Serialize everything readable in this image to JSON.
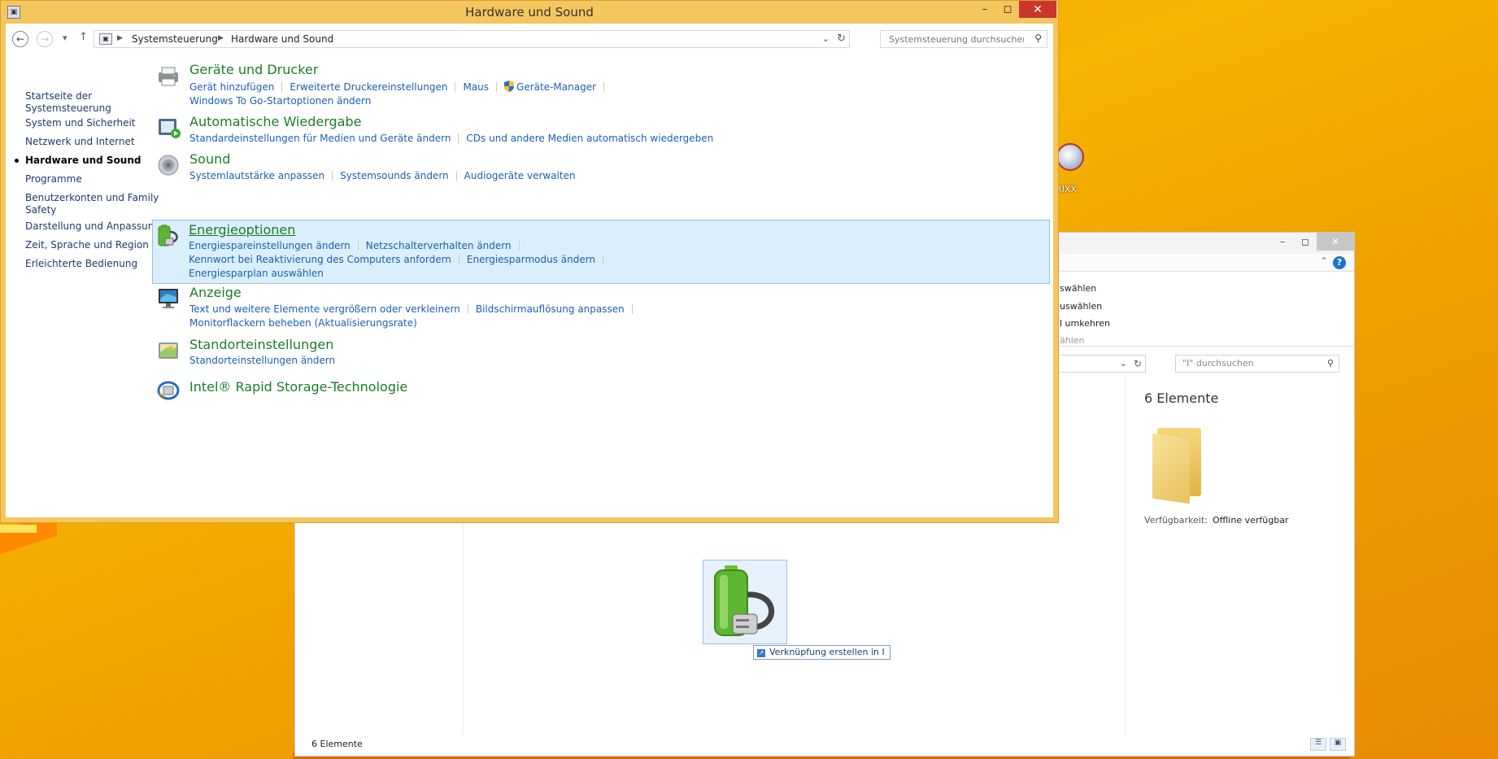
{
  "desktop": {
    "icon_label": "RIXX"
  },
  "explorer": {
    "ribbon_items": [
      "swählen",
      "uswählen",
      "l umkehren",
      "ählen"
    ],
    "search_placeholder": "\"I\" durchsuchen",
    "count_header": "6 Elemente",
    "availability_label": "Verfügbarkeit:",
    "availability_value": "Offline verfügbar",
    "status_text": "6 Elemente",
    "drag_tooltip": "Verknüpfung erstellen in I"
  },
  "window": {
    "title": "Hardware und Sound"
  },
  "address": {
    "crumbs": [
      "Systemsteuerung",
      "Hardware und Sound"
    ],
    "search_placeholder": "Systemsteuerung durchsuchen"
  },
  "sidebar": {
    "items": [
      {
        "label": "Startseite der Systemsteuerung",
        "active": false
      },
      {
        "label": "System und Sicherheit",
        "active": false
      },
      {
        "label": "Netzwerk und Internet",
        "active": false
      },
      {
        "label": "Hardware und Sound",
        "active": true
      },
      {
        "label": "Programme",
        "active": false
      },
      {
        "label": "Benutzerkonten und Family Safety",
        "active": false
      },
      {
        "label": "Darstellung und Anpassung",
        "active": false
      },
      {
        "label": "Zeit, Sprache und Region",
        "active": false
      },
      {
        "label": "Erleichterte Bedienung",
        "active": false
      }
    ]
  },
  "categories": [
    {
      "title": "Geräte und Drucker",
      "icon": "printer-icon",
      "rows": [
        [
          "Gerät hinzufügen",
          "Erweiterte Druckereinstellungen",
          "Maus",
          "Geräte-Manager"
        ],
        [
          "Windows To Go-Startoptionen ändern"
        ]
      ]
    },
    {
      "title": "Automatische Wiedergabe",
      "icon": "autoplay-icon",
      "rows": [
        [
          "Standardeinstellungen für Medien und Geräte ändern",
          "CDs und andere Medien automatisch wiedergeben"
        ]
      ]
    },
    {
      "title": "Sound",
      "icon": "speaker-icon",
      "rows": [
        [
          "Systemlautstärke anpassen",
          "Systemsounds ändern",
          "Audiogeräte verwalten"
        ]
      ]
    },
    {
      "title": "Energieoptionen",
      "icon": "battery-plug-icon",
      "rows": [
        [
          "Energiespareinstellungen ändern",
          "Netzschalterverhalten ändern"
        ],
        [
          "Kennwort bei Reaktivierung des Computers anfordern",
          "Energiesparmodus ändern"
        ],
        [
          "Energiesparplan auswählen"
        ]
      ]
    },
    {
      "title": "Anzeige",
      "icon": "monitor-icon",
      "rows": [
        [
          "Text und weitere Elemente vergrößern oder verkleinern",
          "Bildschirmauflösung anpassen"
        ],
        [
          "Monitorflackern beheben (Aktualisierungsrate)"
        ]
      ]
    },
    {
      "title": "Standorteinstellungen",
      "icon": "location-icon",
      "rows": [
        [
          "Standorteinstellungen ändern"
        ]
      ]
    },
    {
      "title": "Intel® Rapid Storage-Technologie",
      "icon": "intel-rst-icon",
      "rows": []
    }
  ]
}
